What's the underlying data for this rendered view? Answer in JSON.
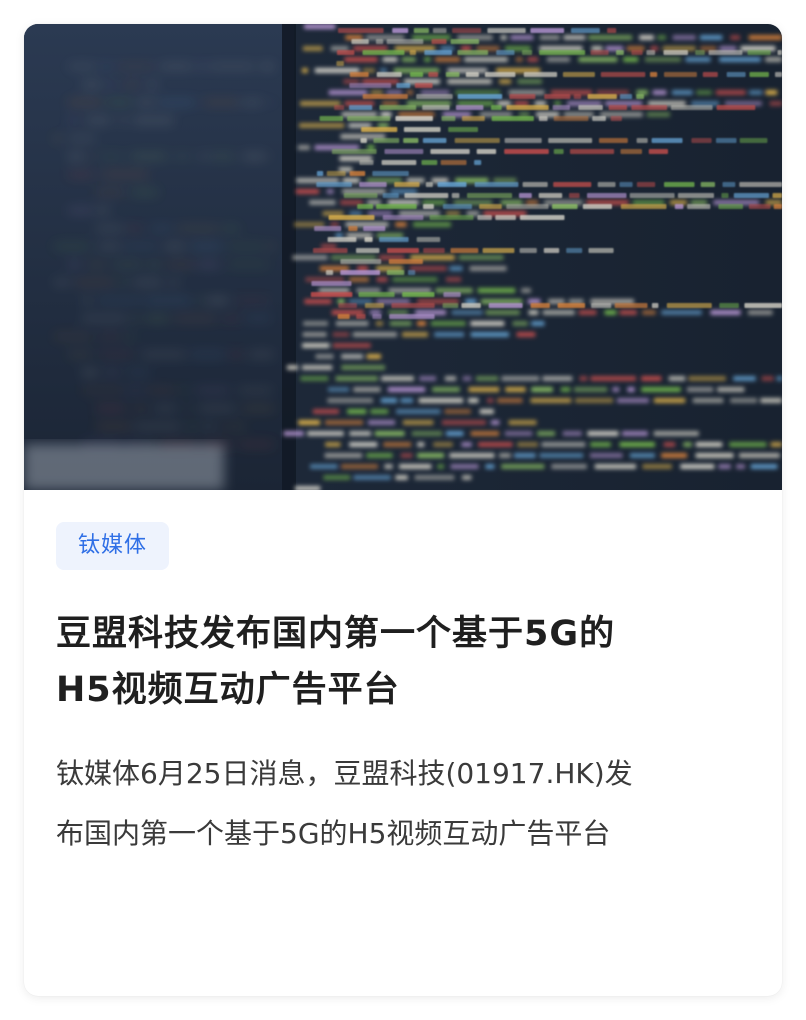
{
  "article": {
    "cover_image": "code-screen-photo",
    "source_tag": "钛媒体",
    "title_line1": "豆盟科技发布国内第一个基于5G的",
    "title_line2": "H5视频互动广告平台",
    "summary_line1": "钛媒体6月25日消息，豆盟科技(01917.HK)发",
    "summary_line2": "布国内第一个基于5G的H5视频互动广告平台"
  },
  "colors": {
    "tag_background": "#eef3fd",
    "tag_text": "#2f6fe6",
    "title": "#1f1f1f",
    "summary": "#3a3a3a",
    "code_background": "#1c2636"
  }
}
